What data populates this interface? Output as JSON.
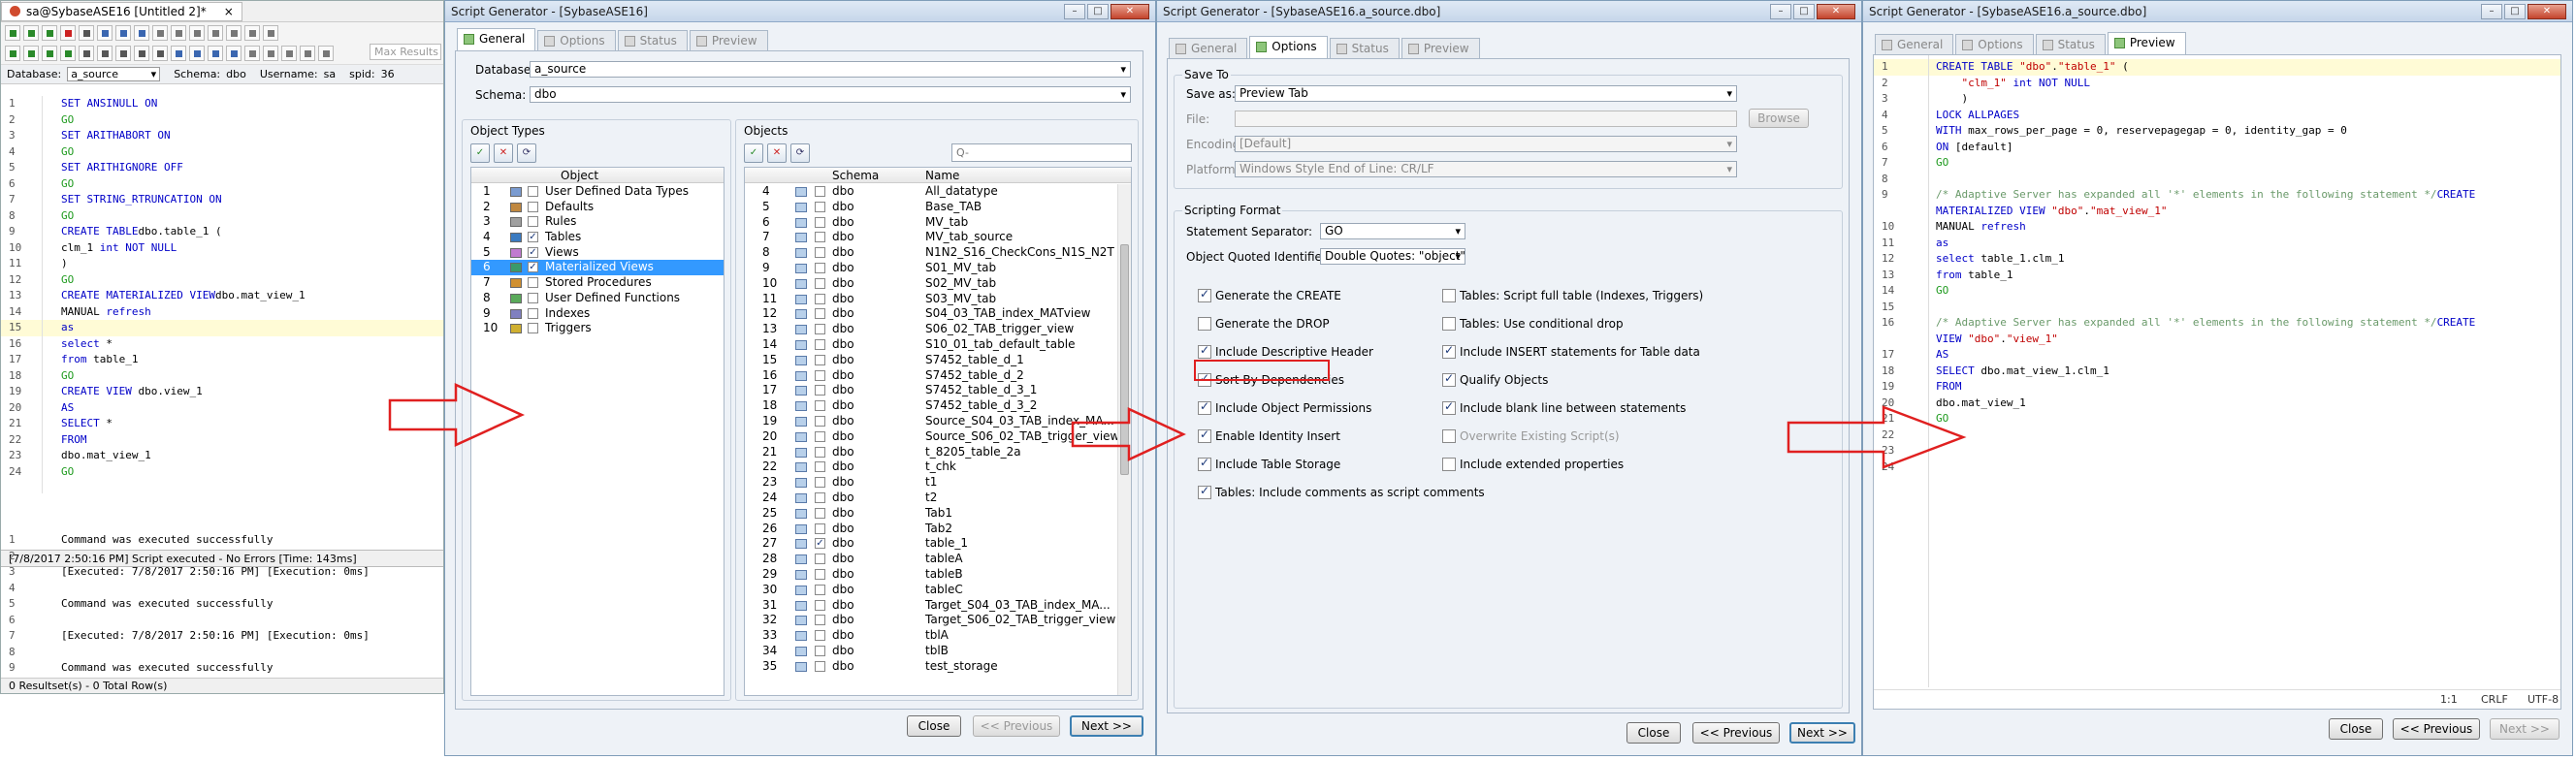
{
  "w1": {
    "title": "sa@SybaseASE16 [Untitled 2]*",
    "tab_close": "×",
    "db_label": "Database:",
    "db": "a_source",
    "schema_label": "Schema:",
    "schema": "dbo",
    "user_label": "Username:",
    "user": "sa",
    "spid_label": "spid:",
    "spid": "36",
    "maxres": "Max Results",
    "code": [
      {
        "n": "1",
        "p": [
          [
            "kw",
            "SET ANSINULL ON"
          ]
        ]
      },
      {
        "n": "2",
        "p": [
          [
            "gr",
            "GO"
          ]
        ]
      },
      {
        "n": "3",
        "p": [
          [
            "kw",
            "SET ARITHABORT ON"
          ]
        ]
      },
      {
        "n": "4",
        "p": [
          [
            "gr",
            "GO"
          ]
        ]
      },
      {
        "n": "5",
        "p": [
          [
            "kw",
            "SET ARITHIGNORE OFF"
          ]
        ]
      },
      {
        "n": "6",
        "p": [
          [
            "gr",
            "GO"
          ]
        ]
      },
      {
        "n": "7",
        "p": [
          [
            "kw",
            "SET STRING_RTRUNCATION ON"
          ]
        ]
      },
      {
        "n": "8",
        "p": [
          [
            "gr",
            "GO"
          ]
        ]
      },
      {
        "n": "9",
        "p": [
          [
            "kw",
            "CREATE TABLE"
          ],
          [
            "",
            "dbo.table_1 ("
          ]
        ]
      },
      {
        "n": "10",
        "p": [
          [
            "",
            "clm_1 "
          ],
          [
            "kw",
            "int NOT NULL"
          ]
        ]
      },
      {
        "n": "11",
        "p": [
          [
            "",
            ")"
          ]
        ]
      },
      {
        "n": "12",
        "p": [
          [
            "gr",
            "GO"
          ]
        ]
      },
      {
        "n": "13",
        "p": [
          [
            "kw",
            "CREATE MATERIALIZED VIEW"
          ],
          [
            "",
            "dbo.mat_view_1"
          ]
        ]
      },
      {
        "n": "14",
        "p": [
          [
            "",
            "MANUAL "
          ],
          [
            "kw",
            "refresh"
          ]
        ]
      },
      {
        "n": "15",
        "p": [
          [
            "kw",
            "as"
          ]
        ]
      },
      {
        "n": "16",
        "p": [
          [
            "kw",
            "select"
          ],
          [
            "",
            " *"
          ]
        ]
      },
      {
        "n": "17",
        "p": [
          [
            "kw",
            "from"
          ],
          [
            "",
            " table_1"
          ]
        ]
      },
      {
        "n": "18",
        "p": [
          [
            "gr",
            "GO"
          ]
        ]
      },
      {
        "n": "19",
        "p": [
          [
            "kw",
            "CREATE VIEW"
          ],
          [
            "",
            " dbo.view_1"
          ]
        ]
      },
      {
        "n": "20",
        "p": [
          [
            "kw",
            "AS"
          ]
        ]
      },
      {
        "n": "21",
        "p": [
          [
            "kw",
            "SELECT"
          ],
          [
            "",
            " *"
          ]
        ]
      },
      {
        "n": "22",
        "p": [
          [
            "kw",
            "FROM"
          ]
        ]
      },
      {
        "n": "23",
        "p": [
          [
            "",
            "dbo.mat_view_1"
          ]
        ]
      },
      {
        "n": "24",
        "p": [
          [
            "gr",
            "GO"
          ]
        ]
      }
    ],
    "status": "[7/8/2017 2:50:16 PM] Script executed - No Errors [Time: 143ms]",
    "output": [
      {
        "n": "1",
        "t": "Command was executed successfully"
      },
      {
        "n": "2",
        "t": ""
      },
      {
        "n": "3",
        "t": "[Executed: 7/8/2017 2:50:16 PM] [Execution: 0ms]"
      },
      {
        "n": "4",
        "t": ""
      },
      {
        "n": "5",
        "t": "Command was executed successfully"
      },
      {
        "n": "6",
        "t": ""
      },
      {
        "n": "7",
        "t": "[Executed: 7/8/2017 2:50:16 PM] [Execution: 0ms]"
      },
      {
        "n": "8",
        "t": ""
      },
      {
        "n": "9",
        "t": "Command was executed successfully"
      }
    ],
    "result_status": "0 Resultset(s) - 0 Total Row(s)"
  },
  "w2": {
    "title": "Script Generator - [SybaseASE16]",
    "tabs": [
      "General",
      "Options",
      "Status",
      "Preview"
    ],
    "db_label": "Database:",
    "db": "a_source",
    "schema_label": "Schema:",
    "schema": "dbo",
    "ot_label": "Object Types",
    "ot_header": "Object",
    "ot": [
      {
        "n": "1",
        "c": false,
        "l": "User Defined Data Types"
      },
      {
        "n": "2",
        "c": false,
        "l": "Defaults"
      },
      {
        "n": "3",
        "c": false,
        "l": "Rules"
      },
      {
        "n": "4",
        "c": true,
        "l": "Tables"
      },
      {
        "n": "5",
        "c": true,
        "l": "Views"
      },
      {
        "n": "6",
        "c": true,
        "l": "Materialized Views"
      },
      {
        "n": "7",
        "c": false,
        "l": "Stored Procedures"
      },
      {
        "n": "8",
        "c": false,
        "l": "User Defined Functions"
      },
      {
        "n": "9",
        "c": false,
        "l": "Indexes"
      },
      {
        "n": "10",
        "c": false,
        "l": "Triggers"
      }
    ],
    "ob_label": "Objects",
    "search_ph": "Q-",
    "ob_schema": "Schema",
    "ob_name": "Name",
    "ob": [
      {
        "n": "4",
        "c": false,
        "s": "dbo",
        "t": "All_datatype"
      },
      {
        "n": "5",
        "c": false,
        "s": "dbo",
        "t": "Base_TAB"
      },
      {
        "n": "6",
        "c": false,
        "s": "dbo",
        "t": "MV_tab"
      },
      {
        "n": "7",
        "c": false,
        "s": "dbo",
        "t": "MV_tab_source"
      },
      {
        "n": "8",
        "c": false,
        "s": "dbo",
        "t": "N1N2_S16_CheckCons_N1S_N2T"
      },
      {
        "n": "9",
        "c": false,
        "s": "dbo",
        "t": "S01_MV_tab"
      },
      {
        "n": "10",
        "c": false,
        "s": "dbo",
        "t": "S02_MV_tab"
      },
      {
        "n": "11",
        "c": false,
        "s": "dbo",
        "t": "S03_MV_tab"
      },
      {
        "n": "12",
        "c": false,
        "s": "dbo",
        "t": "S04_03_TAB_index_MATview"
      },
      {
        "n": "13",
        "c": false,
        "s": "dbo",
        "t": "S06_02_TAB_trigger_view"
      },
      {
        "n": "14",
        "c": false,
        "s": "dbo",
        "t": "S10_01_tab_default_table"
      },
      {
        "n": "15",
        "c": false,
        "s": "dbo",
        "t": "S7452_table_d_1"
      },
      {
        "n": "16",
        "c": false,
        "s": "dbo",
        "t": "S7452_table_d_2"
      },
      {
        "n": "17",
        "c": false,
        "s": "dbo",
        "t": "S7452_table_d_3_1"
      },
      {
        "n": "18",
        "c": false,
        "s": "dbo",
        "t": "S7452_table_d_3_2"
      },
      {
        "n": "19",
        "c": false,
        "s": "dbo",
        "t": "Source_S04_03_TAB_index_MA..."
      },
      {
        "n": "20",
        "c": false,
        "s": "dbo",
        "t": "Source_S06_02_TAB_trigger_view"
      },
      {
        "n": "21",
        "c": false,
        "s": "dbo",
        "t": "t_8205_table_2a"
      },
      {
        "n": "22",
        "c": false,
        "s": "dbo",
        "t": "t_chk"
      },
      {
        "n": "23",
        "c": false,
        "s": "dbo",
        "t": "t1"
      },
      {
        "n": "24",
        "c": false,
        "s": "dbo",
        "t": "t2"
      },
      {
        "n": "25",
        "c": false,
        "s": "dbo",
        "t": "Tab1"
      },
      {
        "n": "26",
        "c": false,
        "s": "dbo",
        "t": "Tab2"
      },
      {
        "n": "27",
        "c": true,
        "s": "dbo",
        "t": "table_1"
      },
      {
        "n": "28",
        "c": false,
        "s": "dbo",
        "t": "tableA"
      },
      {
        "n": "29",
        "c": false,
        "s": "dbo",
        "t": "tableB"
      },
      {
        "n": "30",
        "c": false,
        "s": "dbo",
        "t": "tableC"
      },
      {
        "n": "31",
        "c": false,
        "s": "dbo",
        "t": "Target_S04_03_TAB_index_MA..."
      },
      {
        "n": "32",
        "c": false,
        "s": "dbo",
        "t": "Target_S06_02_TAB_trigger_view"
      },
      {
        "n": "33",
        "c": false,
        "s": "dbo",
        "t": "tblA"
      },
      {
        "n": "34",
        "c": false,
        "s": "dbo",
        "t": "tblB"
      },
      {
        "n": "35",
        "c": false,
        "s": "dbo",
        "t": "test_storage"
      }
    ],
    "close": "Close",
    "prev": "<< Previous",
    "next": "Next >>"
  },
  "w3": {
    "title": "Script Generator - [SybaseASE16.a_source.dbo]",
    "tabs": [
      "General",
      "Options",
      "Status",
      "Preview"
    ],
    "save_group": "Save To",
    "save_as_label": "Save as:",
    "save_as": "Preview Tab",
    "file_label": "File:",
    "browse": "Browse",
    "enc_label": "Encoding:",
    "enc": "[Default]",
    "plat_label": "Platform:",
    "plat": "Windows Style End of Line: CR/LF",
    "fmt_group": "Scripting Format",
    "sep_label": "Statement Separator:",
    "sep": "GO",
    "oqi_label": "Object Quoted Identifier:",
    "oqi": "Double Quotes: \"object\"",
    "left": [
      {
        "c": true,
        "l": "Generate the CREATE",
        "d": false
      },
      {
        "c": false,
        "l": "Generate the DROP",
        "d": false
      },
      {
        "c": true,
        "l": "Include Descriptive Header",
        "d": false
      },
      {
        "c": true,
        "l": "Sort By Dependencies",
        "d": false
      },
      {
        "c": true,
        "l": "Include Object Permissions",
        "d": false
      },
      {
        "c": true,
        "l": "Enable Identity Insert",
        "d": false
      },
      {
        "c": true,
        "l": "Include Table Storage",
        "d": false
      },
      {
        "c": true,
        "l": "Tables: Include comments as script comments",
        "d": false
      }
    ],
    "right": [
      {
        "c": false,
        "l": "Tables: Script full table (Indexes, Triggers)",
        "d": false
      },
      {
        "c": false,
        "l": "Tables: Use conditional drop",
        "d": false
      },
      {
        "c": true,
        "l": "Include INSERT statements for Table data",
        "d": false
      },
      {
        "c": true,
        "l": "Qualify Objects",
        "d": false
      },
      {
        "c": true,
        "l": "Include blank line between statements",
        "d": false
      },
      {
        "c": false,
        "l": "Overwrite Existing Script(s)",
        "d": true
      },
      {
        "c": false,
        "l": "Include extended properties",
        "d": false
      }
    ],
    "close": "Close",
    "prev": "<< Previous",
    "next": "Next >>"
  },
  "w4": {
    "title": "Script Generator - [SybaseASE16.a_source.dbo]",
    "tabs": [
      "General",
      "Options",
      "Status",
      "Preview"
    ],
    "code": [
      {
        "n": "1",
        "p": [
          [
            "kw",
            "CREATE TABLE "
          ],
          [
            "str",
            "\"dbo\""
          ],
          [
            "",
            "."
          ],
          [
            "str",
            "\"table_1\""
          ],
          [
            "",
            " ("
          ]
        ]
      },
      {
        "n": "2",
        "p": [
          [
            "",
            "    "
          ],
          [
            "str",
            "\"clm_1\""
          ],
          [
            "kw",
            " int NOT NULL"
          ]
        ]
      },
      {
        "n": "3",
        "p": [
          [
            "",
            "    )"
          ]
        ]
      },
      {
        "n": "4",
        "p": [
          [
            "kw",
            "LOCK ALLPAGES"
          ]
        ]
      },
      {
        "n": "5",
        "p": [
          [
            "kw",
            "WITH "
          ],
          [
            "",
            "max_rows_per_page = 0, reservepagegap = 0, identity_gap = 0"
          ]
        ]
      },
      {
        "n": "6",
        "p": [
          [
            "kw",
            "ON "
          ],
          [
            "",
            "[default]"
          ]
        ]
      },
      {
        "n": "7",
        "p": [
          [
            "gr",
            "GO"
          ]
        ]
      },
      {
        "n": "8",
        "p": []
      },
      {
        "n": "9",
        "p": [
          [
            "cmt",
            "/* Adaptive Server has expanded all '*' elements in the following statement */"
          ],
          [
            "kw",
            "CREATE"
          ]
        ]
      },
      {
        "n": "",
        "p": [
          [
            "kw",
            "MATERIALIZED VIEW "
          ],
          [
            "str",
            "\"dbo\""
          ],
          [
            "",
            "."
          ],
          [
            "str",
            "\"mat_view_1\""
          ]
        ]
      },
      {
        "n": "10",
        "p": [
          [
            "",
            "MANUAL "
          ],
          [
            "kw",
            "refresh"
          ]
        ]
      },
      {
        "n": "11",
        "p": [
          [
            "kw",
            "as"
          ]
        ]
      },
      {
        "n": "12",
        "p": [
          [
            "kw",
            "select "
          ],
          [
            "",
            "table_1.clm_1"
          ]
        ]
      },
      {
        "n": "13",
        "p": [
          [
            "kw",
            "from "
          ],
          [
            "",
            "table_1"
          ]
        ]
      },
      {
        "n": "14",
        "p": [
          [
            "gr",
            "GO"
          ]
        ]
      },
      {
        "n": "15",
        "p": []
      },
      {
        "n": "16",
        "p": [
          [
            "cmt",
            "/* Adaptive Server has expanded all '*' elements in the following statement */"
          ],
          [
            "kw",
            "CREATE"
          ]
        ]
      },
      {
        "n": "",
        "p": [
          [
            "kw",
            "VIEW "
          ],
          [
            "str",
            "\"dbo\""
          ],
          [
            "",
            "."
          ],
          [
            "str",
            "\"view_1\""
          ]
        ]
      },
      {
        "n": "17",
        "p": [
          [
            "kw",
            "AS"
          ]
        ]
      },
      {
        "n": "18",
        "p": [
          [
            "kw",
            "SELECT "
          ],
          [
            "",
            "dbo.mat_view_1.clm_1"
          ]
        ]
      },
      {
        "n": "19",
        "p": [
          [
            "kw",
            "FROM"
          ]
        ]
      },
      {
        "n": "20",
        "p": [
          [
            "",
            "dbo.mat_view_1"
          ]
        ]
      },
      {
        "n": "21",
        "p": [
          [
            "gr",
            "GO"
          ]
        ]
      },
      {
        "n": "22",
        "p": []
      },
      {
        "n": "23",
        "p": []
      },
      {
        "n": "24",
        "p": []
      }
    ],
    "pos": "1:1",
    "eol": "CRLF",
    "enc": "UTF-8",
    "close": "Close",
    "prev": "<< Previous",
    "next": "Next >>"
  },
  "colors": {
    "accent": "#3399ff",
    "arrow": "#e02020",
    "keyword": "#0000c8",
    "string": "#c00000"
  }
}
